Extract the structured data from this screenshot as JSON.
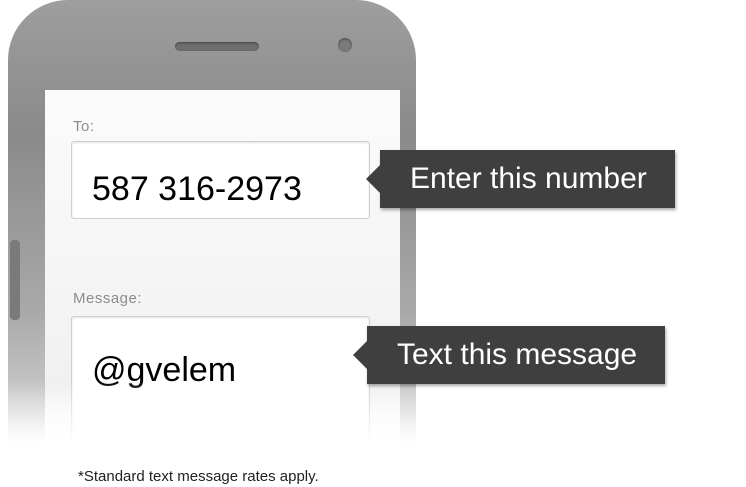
{
  "form": {
    "to_label": "To:",
    "to_value": "587 316-2973",
    "message_label": "Message:",
    "message_value": "@gvelem"
  },
  "callouts": {
    "number": "Enter this number",
    "message": "Text this message"
  },
  "footnote": "*Standard text message rates apply.",
  "colors": {
    "phone_body": "#9e9e9e",
    "callout_bg": "#3f3f3f",
    "callout_text": "#ffffff",
    "label_text": "#8c8c8c"
  }
}
